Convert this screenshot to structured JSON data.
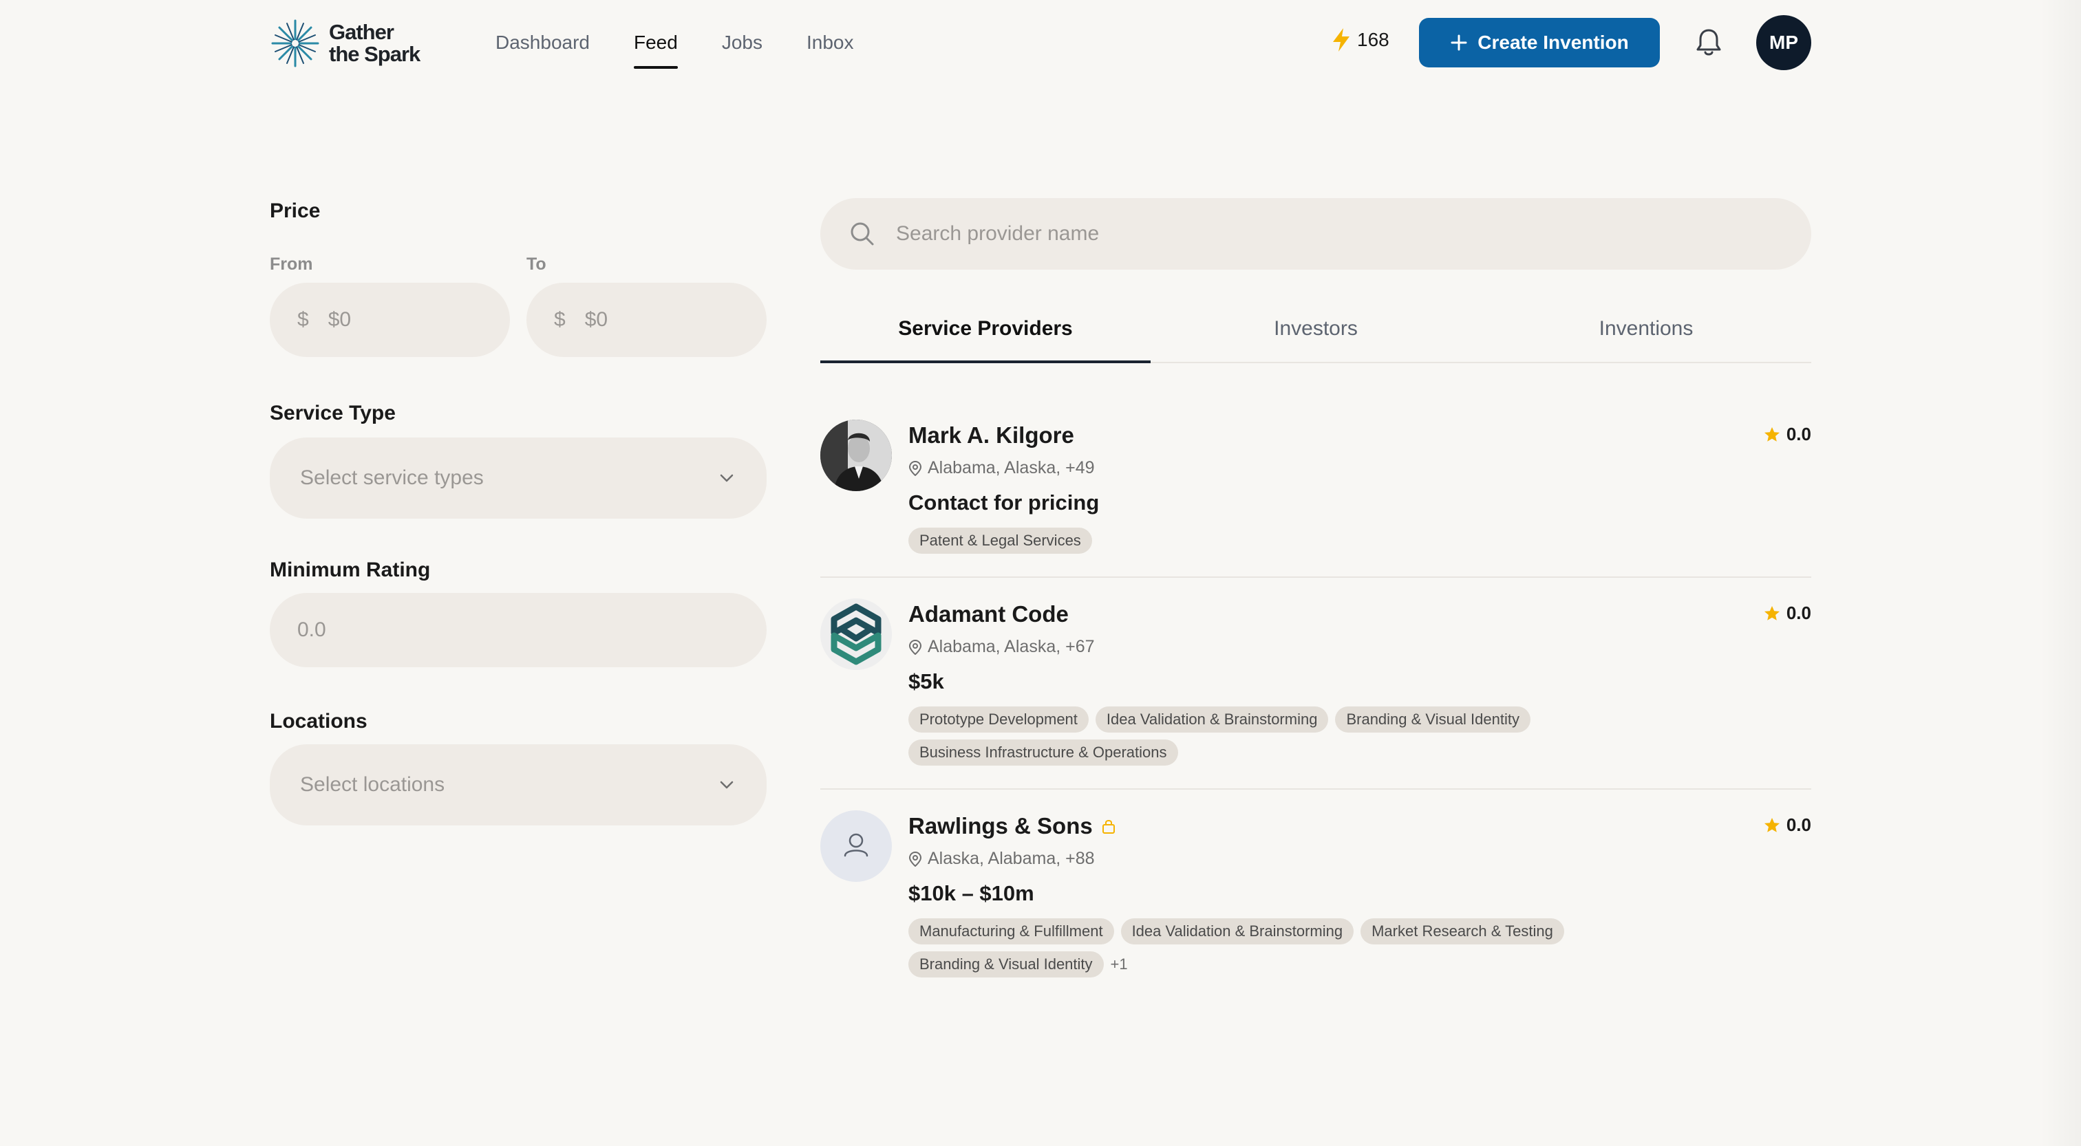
{
  "header": {
    "logo_line1": "Gather",
    "logo_line2": "the Spark",
    "nav": [
      {
        "label": "Dashboard",
        "active": false
      },
      {
        "label": "Feed",
        "active": true
      },
      {
        "label": "Jobs",
        "active": false
      },
      {
        "label": "Inbox",
        "active": false
      }
    ],
    "credits": "168",
    "create_button": "Create Invention",
    "user_initials": "MP",
    "icons": {
      "credits": "lightning-icon",
      "create": "plus-icon",
      "notifications": "bell-icon"
    }
  },
  "filters": {
    "price": {
      "title": "Price",
      "from_label": "From",
      "to_label": "To",
      "currency": "$",
      "from_placeholder": "$0",
      "to_placeholder": "$0"
    },
    "service_type": {
      "title": "Service Type",
      "placeholder": "Select service types"
    },
    "minimum_rating": {
      "title": "Minimum Rating",
      "placeholder": "0.0"
    },
    "locations": {
      "title": "Locations",
      "placeholder": "Select locations"
    }
  },
  "search": {
    "placeholder": "Search provider name"
  },
  "tabs": [
    {
      "label": "Service Providers",
      "active": true
    },
    {
      "label": "Investors",
      "active": false
    },
    {
      "label": "Inventions",
      "active": false
    }
  ],
  "providers": [
    {
      "name": "Mark A. Kilgore",
      "location": "Alabama, Alaska, +49",
      "price": "Contact for pricing",
      "rating": "0.0",
      "tags": [
        "Patent & Legal Services"
      ],
      "more": "",
      "locked": false,
      "avatar": "photo"
    },
    {
      "name": "Adamant Code",
      "location": "Alabama, Alaska, +67",
      "price": "$5k",
      "rating": "0.0",
      "tags": [
        "Prototype Development",
        "Idea Validation & Brainstorming",
        "Branding & Visual Identity",
        "Business Infrastructure & Operations"
      ],
      "more": "",
      "locked": false,
      "avatar": "logo"
    },
    {
      "name": "Rawlings & Sons",
      "location": "Alaska, Alabama, +88",
      "price": "$10k – $10m",
      "rating": "0.0",
      "tags": [
        "Manufacturing & Fulfillment",
        "Idea Validation & Brainstorming",
        "Market Research & Testing",
        "Branding & Visual Identity"
      ],
      "more": "+1",
      "locked": true,
      "avatar": "placeholder"
    }
  ],
  "colors": {
    "accent": "#0b63a5",
    "star": "#f5b301",
    "lightning": "#f5b301",
    "lock": "#f5b301"
  }
}
